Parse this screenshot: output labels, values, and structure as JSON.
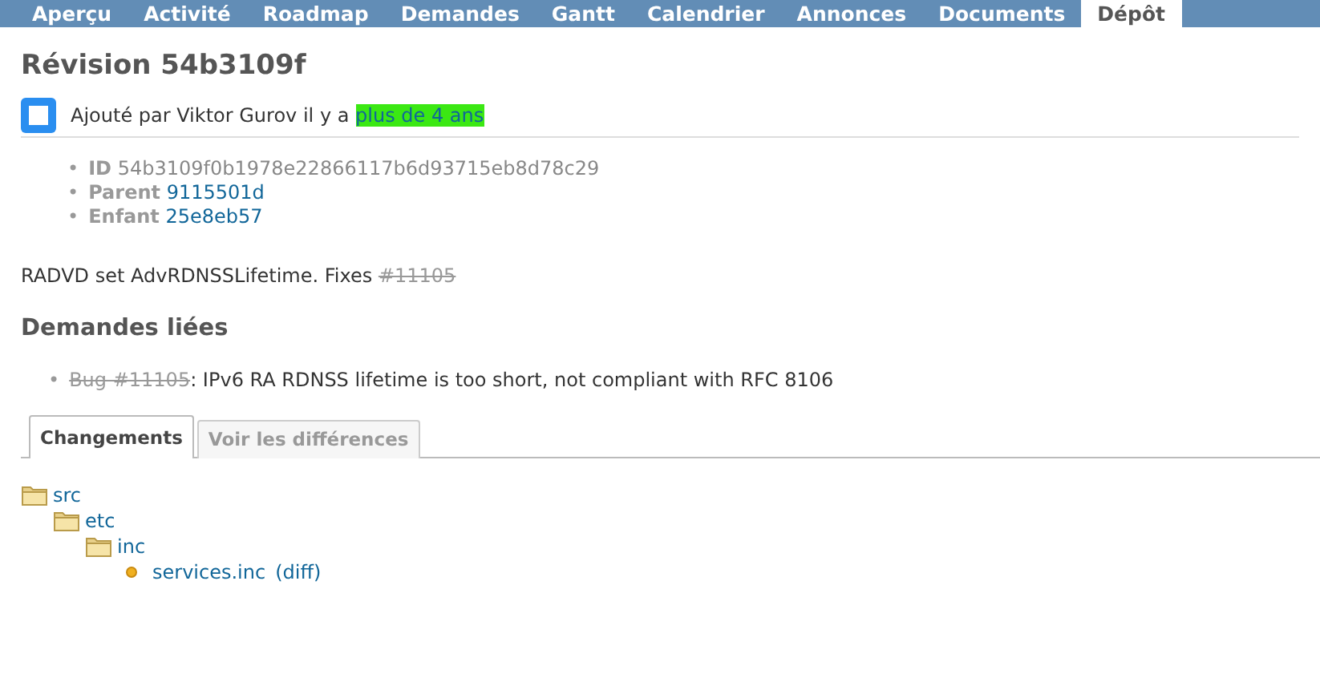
{
  "tabs": [
    {
      "label": "Aperçu",
      "selected": false
    },
    {
      "label": "Activité",
      "selected": false
    },
    {
      "label": "Roadmap",
      "selected": false
    },
    {
      "label": "Demandes",
      "selected": false
    },
    {
      "label": "Gantt",
      "selected": false
    },
    {
      "label": "Calendrier",
      "selected": false
    },
    {
      "label": "Annonces",
      "selected": false
    },
    {
      "label": "Documents",
      "selected": false
    },
    {
      "label": "Dépôt",
      "selected": true
    }
  ],
  "title": "Révision 54b3109f",
  "added_by": {
    "text": "Ajouté par Viktor Gurov il y a",
    "age": "plus de 4 ans"
  },
  "properties": [
    {
      "marker": "•",
      "label": "ID",
      "value": "54b3109f0b1978e22866117b6d93715eb8d78c29",
      "kind": "text"
    },
    {
      "marker": "•",
      "label": "Parent",
      "value": "9115501d",
      "kind": "link"
    },
    {
      "marker": "•",
      "label": "Enfant",
      "value": "25e8eb57",
      "kind": "link"
    }
  ],
  "message": {
    "text": "RADVD set AdvRDNSSLifetime. Fixes",
    "issue": "#11105",
    "closed": true
  },
  "related": {
    "heading": "Demandes liées",
    "items": [
      {
        "marker": "•",
        "issue": "Bug #11105",
        "closed": true,
        "subject": ": IPv6 RA RDNSS lifetime is too short, not compliant with RFC 8106"
      }
    ]
  },
  "change_tabs": [
    {
      "label": "Changements",
      "selected": true
    },
    {
      "label": "Voir les différences",
      "selected": false
    }
  ],
  "tree": [
    {
      "kind": "folder",
      "name": "src",
      "children": [
        {
          "kind": "folder",
          "name": "etc",
          "children": [
            {
              "kind": "folder",
              "name": "inc",
              "children": [
                {
                  "kind": "file",
                  "name": "services.inc",
                  "diff": "(diff)"
                }
              ]
            }
          ]
        }
      ]
    }
  ]
}
